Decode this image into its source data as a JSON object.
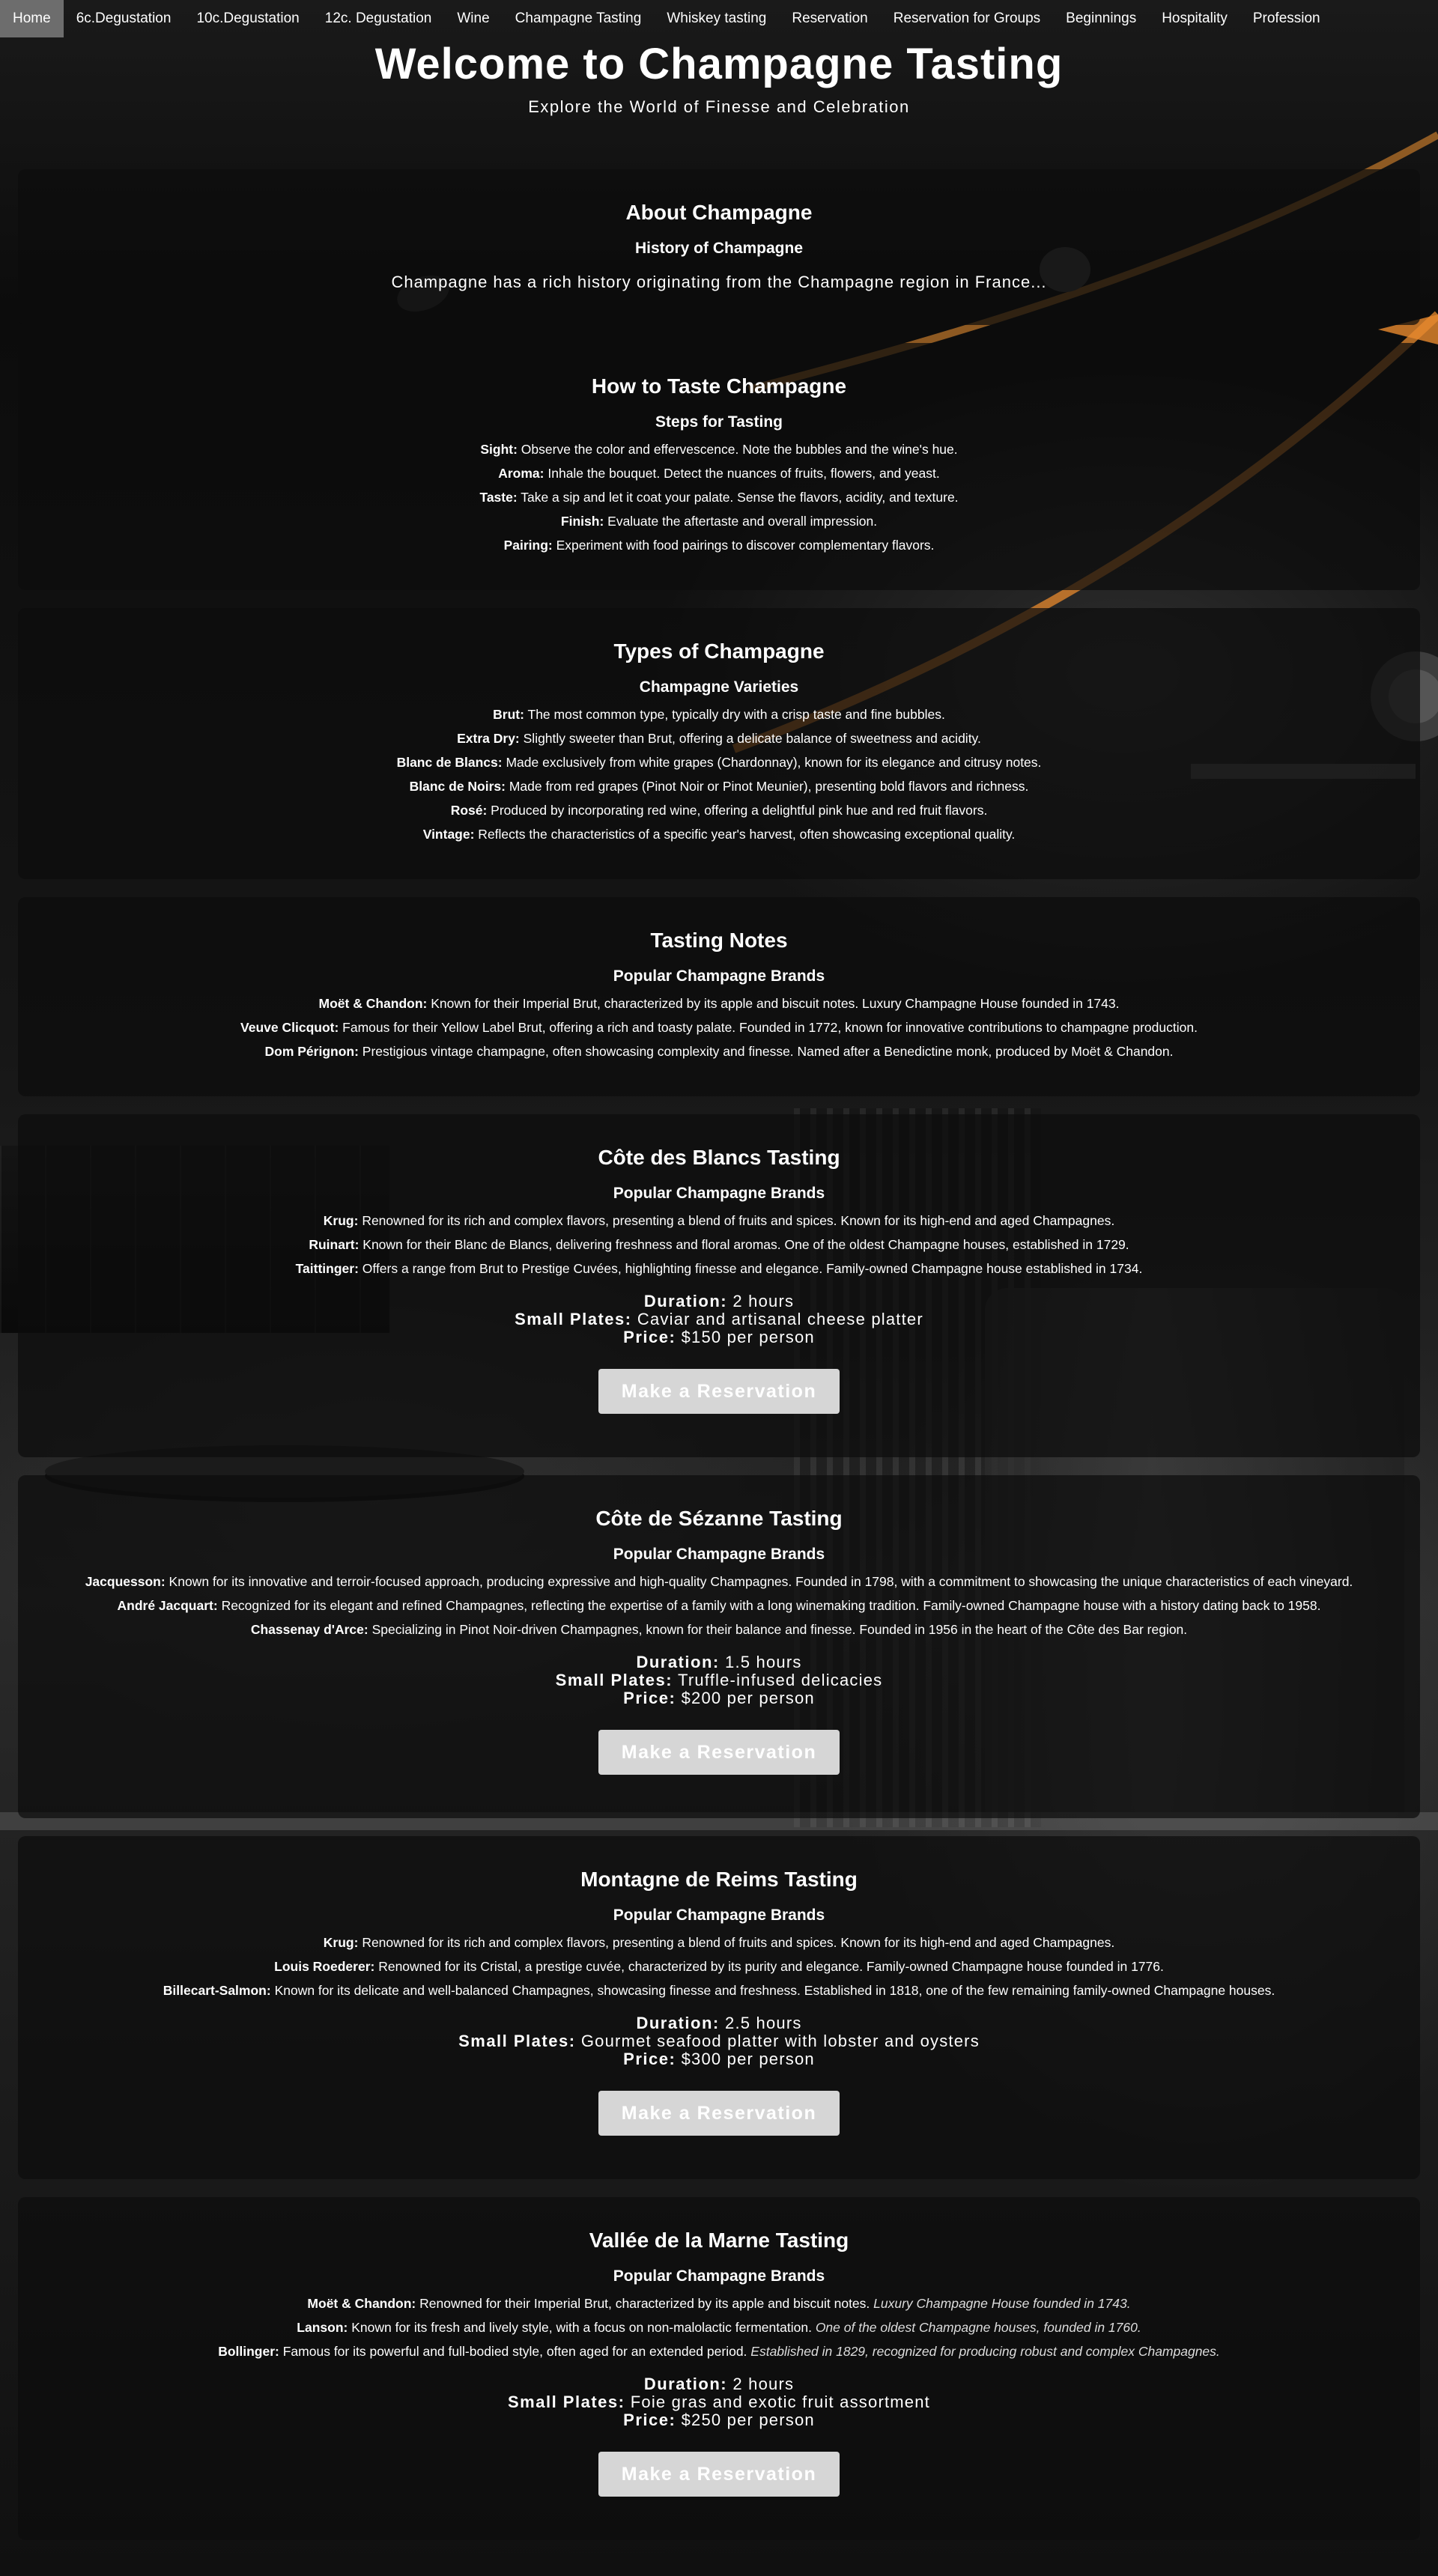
{
  "nav": [
    {
      "label": "Home",
      "active": true
    },
    {
      "label": "6c.Degustation"
    },
    {
      "label": "10c.Degustation"
    },
    {
      "label": "12c. Degustation"
    },
    {
      "label": "Wine"
    },
    {
      "label": "Champagne Tasting"
    },
    {
      "label": "Whiskey tasting"
    },
    {
      "label": "Reservation"
    },
    {
      "label": "Reservation for Groups"
    },
    {
      "label": "Beginnings"
    },
    {
      "label": "Hospitality"
    },
    {
      "label": "Profession"
    }
  ],
  "hero": {
    "title": "Welcome to Champagne Tasting",
    "subtitle": "Explore the World of Finesse and Celebration"
  },
  "about": {
    "title": "About Champagne",
    "subtitle": "History of Champagne",
    "text": "Champagne has a rich history originating from the Champagne region in France..."
  },
  "how_to": {
    "title": "How to Taste Champagne",
    "subtitle": "Steps for Tasting",
    "items": [
      {
        "term": "Sight:",
        "text": " Observe the color and effervescence. Note the bubbles and the wine's hue."
      },
      {
        "term": "Aroma:",
        "text": " Inhale the bouquet. Detect the nuances of fruits, flowers, and yeast."
      },
      {
        "term": "Taste:",
        "text": " Take a sip and let it coat your palate. Sense the flavors, acidity, and texture."
      },
      {
        "term": "Finish:",
        "text": " Evaluate the aftertaste and overall impression."
      },
      {
        "term": "Pairing:",
        "text": " Experiment with food pairings to discover complementary flavors."
      }
    ]
  },
  "types": {
    "title": "Types of Champagne",
    "subtitle": "Champagne Varieties",
    "items": [
      {
        "term": "Brut:",
        "text": " The most common type, typically dry with a crisp taste and fine bubbles."
      },
      {
        "term": "Extra Dry:",
        "text": " Slightly sweeter than Brut, offering a delicate balance of sweetness and acidity."
      },
      {
        "term": "Blanc de Blancs:",
        "text": " Made exclusively from white grapes (Chardonnay), known for its elegance and citrusy notes."
      },
      {
        "term": "Blanc de Noirs:",
        "text": " Made from red grapes (Pinot Noir or Pinot Meunier), presenting bold flavors and richness."
      },
      {
        "term": "Rosé:",
        "text": " Produced by incorporating red wine, offering a delightful pink hue and red fruit flavors."
      },
      {
        "term": "Vintage:",
        "text": " Reflects the characteristics of a specific year's harvest, often showcasing exceptional quality."
      }
    ]
  },
  "notes": {
    "title": "Tasting Notes",
    "subtitle": "Popular Champagne Brands",
    "items": [
      {
        "term": "Moët & Chandon:",
        "text": " Known for their Imperial Brut, characterized by its apple and biscuit notes. Luxury Champagne House founded in 1743."
      },
      {
        "term": "Veuve Clicquot:",
        "text": " Famous for their Yellow Label Brut, offering a rich and toasty palate. Founded in 1772, known for innovative contributions to champagne production."
      },
      {
        "term": "Dom Pérignon:",
        "text": " Prestigious vintage champagne, often showcasing complexity and finesse. Named after a Benedictine monk, produced by Moët & Chandon."
      }
    ]
  },
  "tastings": [
    {
      "title": "Côte des Blancs Tasting",
      "subtitle": "Popular Champagne Brands",
      "items": [
        {
          "term": "Krug:",
          "text": " Renowned for its rich and complex flavors, presenting a blend of fruits and spices. Known for its high-end and aged Champagnes."
        },
        {
          "term": "Ruinart:",
          "text": " Known for their Blanc de Blancs, delivering freshness and floral aromas. One of the oldest Champagne houses, established in 1729."
        },
        {
          "term": "Taittinger:",
          "text": " Offers a range from Brut to Prestige Cuvées, highlighting finesse and elegance. Family-owned Champagne house established in 1734."
        }
      ],
      "duration_label": "Duration:",
      "duration": " 2 hours",
      "plates_label": "Small Plates:",
      "plates": " Caviar and artisanal cheese platter",
      "price_label": "Price:",
      "price": " $150 per person",
      "button": "Make a Reservation"
    },
    {
      "title": "Côte de Sézanne Tasting",
      "subtitle": "Popular Champagne Brands",
      "items": [
        {
          "term": "Jacquesson:",
          "text": " Known for its innovative and terroir-focused approach, producing expressive and high-quality Champagnes. Founded in 1798, with a commitment to showcasing the unique characteristics of each vineyard."
        },
        {
          "term": "André Jacquart:",
          "text": " Recognized for its elegant and refined Champagnes, reflecting the expertise of a family with a long winemaking tradition. Family-owned Champagne house with a history dating back to 1958."
        },
        {
          "term": "Chassenay d'Arce:",
          "text": " Specializing in Pinot Noir-driven Champagnes, known for their balance and finesse. Founded in 1956 in the heart of the Côte des Bar region."
        }
      ],
      "duration_label": "Duration:",
      "duration": " 1.5 hours",
      "plates_label": "Small Plates:",
      "plates": " Truffle-infused delicacies",
      "price_label": "Price:",
      "price": " $200 per person",
      "button": "Make a Reservation"
    },
    {
      "title": "Montagne de Reims Tasting",
      "subtitle": "Popular Champagne Brands",
      "items": [
        {
          "term": "Krug:",
          "text": " Renowned for its rich and complex flavors, presenting a blend of fruits and spices. Known for its high-end and aged Champagnes."
        },
        {
          "term": "Louis Roederer:",
          "text": " Renowned for its Cristal, a prestige cuvée, characterized by its purity and elegance. Family-owned Champagne house founded in 1776."
        },
        {
          "term": "Billecart-Salmon:",
          "text": " Known for its delicate and well-balanced Champagnes, showcasing finesse and freshness. Established in 1818, one of the few remaining family-owned Champagne houses."
        }
      ],
      "duration_label": "Duration:",
      "duration": " 2.5 hours",
      "plates_label": "Small Plates:",
      "plates": " Gourmet seafood platter with lobster and oysters",
      "price_label": "Price:",
      "price": " $300 per person",
      "button": "Make a Reservation"
    },
    {
      "title": "Vallée de la Marne Tasting",
      "subtitle": "Popular Champagne Brands",
      "items": [
        {
          "term": "Moët & Chandon:",
          "text": " Renowned for their Imperial Brut, characterized by its apple and biscuit notes. ",
          "note": "Luxury Champagne House founded in 1743."
        },
        {
          "term": "Lanson:",
          "text": " Known for its fresh and lively style, with a focus on non-malolactic fermentation. ",
          "note": "One of the oldest Champagne houses, founded in 1760."
        },
        {
          "term": "Bollinger:",
          "text": " Famous for its powerful and full-bodied style, often aged for an extended period. ",
          "note": "Established in 1829, recognized for producing robust and complex Champagnes."
        }
      ],
      "duration_label": "Duration:",
      "duration": " 2 hours",
      "plates_label": "Small Plates:",
      "plates": " Foie gras and exotic fruit assortment",
      "price_label": "Price:",
      "price": " $250 per person",
      "button": "Make a Reservation"
    }
  ],
  "colors": {
    "nav_active": "#6d6d6d",
    "button": "#d6d6d6",
    "accent_streak": "#e8892e"
  }
}
